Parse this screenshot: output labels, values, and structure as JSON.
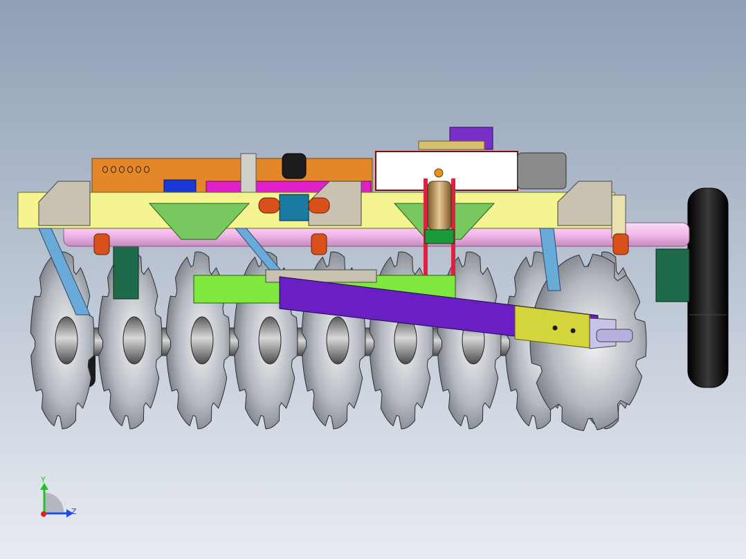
{
  "viewport": {
    "background_top": "#8f9fb5",
    "background_bottom": "#e8ecf2"
  },
  "model": {
    "part_colors": {
      "main_frame": "#f4f590",
      "outer_gusset": "#c9c2b0",
      "inner_gusset": "#78c860",
      "gang_beam": "#7ee83c",
      "drawbar": "#6a1fc4",
      "drawbar_end": "#d4d43c",
      "hitch_plate": "#c8c3e8",
      "pink_axle": "#f2b9e9",
      "orange_bar": "#e3882a",
      "magenta_bar": "#e020c8",
      "blue_block": "#1a3ad8",
      "purple_block": "#7a2ec8",
      "spring_box": "#ffffff",
      "spring_post": "#e02040",
      "teal_clamp": "#1a7aa0",
      "orange_clamp": "#d8501a",
      "blue_strut": "#3a7ad8",
      "light_blue_strut": "#6aaad8",
      "dark_green_block": "#1f6a4a",
      "disc_blade": "#9aa0a8",
      "hub": "#7a7a7c",
      "tire": "#1c1c1c"
    },
    "disc_count": 9
  },
  "triad": {
    "y_label": "Y",
    "z_label": "Z",
    "y_color": "#22c022",
    "z_color": "#1a4ae0",
    "x_color": "#e02020"
  }
}
